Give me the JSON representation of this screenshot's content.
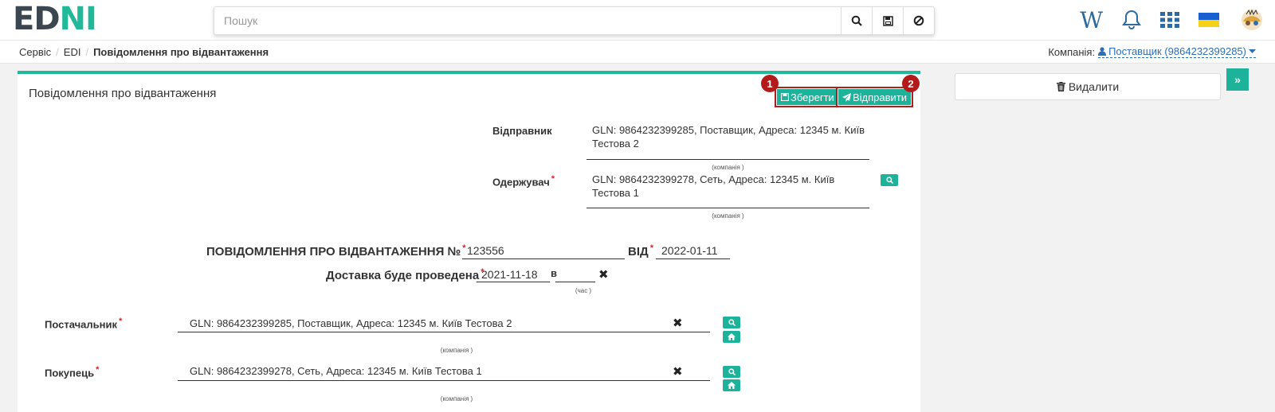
{
  "logo": {
    "left": "ED",
    "right": "NI"
  },
  "search": {
    "placeholder": "Пошук"
  },
  "breadcrumb": {
    "items": [
      "Сервіс",
      "EDI"
    ],
    "current": "Повідомлення про відвантаження"
  },
  "company": {
    "label": "Компанія:",
    "value": "Поставщик (9864232399285)"
  },
  "panel": {
    "title": "Повідомлення про відвантаження"
  },
  "actions": {
    "save": "Зберегти",
    "send": "Відправити",
    "badge1": "1",
    "badge2": "2"
  },
  "sender": {
    "label": "Відправник",
    "line1": "GLN: 9864232399285, Поставщик, Адреса: 12345 м. Київ",
    "line2": "Тестова 2",
    "caption": "(компанія )"
  },
  "receiver": {
    "label": "Одержувач",
    "line1": "GLN: 9864232399278, Сеть, Адреса: 12345 м. Київ",
    "line2": "Тестова 1",
    "caption": "(компанія )"
  },
  "doc": {
    "title": "ПОВІДОМЛЕННЯ ПРО ВІДВАНТАЖЕННЯ №",
    "number": "123556",
    "from_label": "ВІД",
    "date": "2022-01-11"
  },
  "delivery": {
    "label": "Доставка буде проведена",
    "date": "2021-11-18",
    "at": "в",
    "time": "",
    "time_caption": "(час )"
  },
  "supplier": {
    "label": "Постачальник",
    "value": "GLN: 9864232399285, Поставщик, Адреса: 12345 м. Київ Тестова 2",
    "caption": "(компанія )"
  },
  "buyer": {
    "label": "Покупець",
    "value": "GLN: 9864232399278, Сеть, Адреса: 12345 м. Київ Тестова 1",
    "caption": "(компанія )"
  },
  "right": {
    "delete": "Видалити"
  },
  "colors": {
    "accent": "#1cb39a",
    "badge": "#b31b1b",
    "link": "#2e6fb4"
  }
}
